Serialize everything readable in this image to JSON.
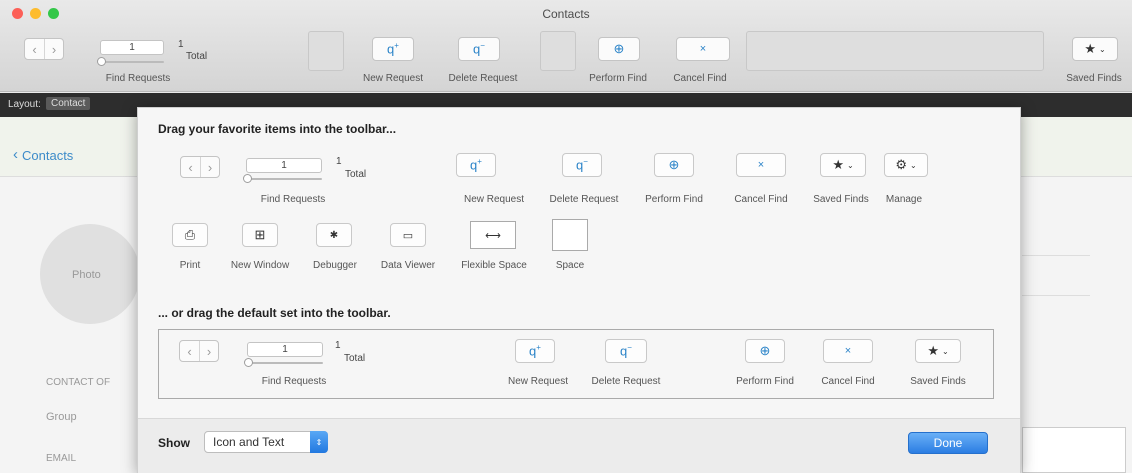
{
  "window": {
    "title": "Contacts"
  },
  "toolbar": {
    "record_current": "1",
    "record_total": "1",
    "record_total_label": "Total",
    "find_requests_label": "Find Requests",
    "new_request_label": "New Request",
    "delete_request_label": "Delete Request",
    "perform_find_label": "Perform Find",
    "cancel_find_label": "Cancel Find",
    "saved_finds_label": "Saved Finds"
  },
  "layout_bar": {
    "layout_label": "Layout:",
    "layout_value": "Contact"
  },
  "background": {
    "back_link": "Contacts",
    "photo_label": "Photo",
    "section_label": "CONTACT OF",
    "group_label": "Group",
    "email_label": "EMAIL"
  },
  "customize": {
    "heading_items": "Drag your favorite items into the toolbar...",
    "heading_default": "... or drag the default set into the toolbar.",
    "palette": {
      "record_current": "1",
      "record_total": "1",
      "record_total_label": "Total",
      "find_requests": "Find Requests",
      "new_request": "New Request",
      "delete_request": "Delete Request",
      "perform_find": "Perform Find",
      "cancel_find": "Cancel Find",
      "saved_finds": "Saved Finds",
      "manage": "Manage",
      "print": "Print",
      "new_window": "New Window",
      "debugger": "Debugger",
      "data_viewer": "Data Viewer",
      "flexible_space": "Flexible Space",
      "space": "Space"
    },
    "default_set": {
      "record_current": "1",
      "record_total": "1",
      "record_total_label": "Total",
      "find_requests": "Find Requests",
      "new_request": "New Request",
      "delete_request": "Delete Request",
      "perform_find": "Perform Find",
      "cancel_find": "Cancel Find",
      "saved_finds": "Saved Finds"
    },
    "show_label": "Show",
    "show_value": "Icon and Text",
    "done_label": "Done"
  },
  "colors": {
    "accent": "#2a83c8",
    "close": "#fc5f57",
    "minimize": "#fdbc2e",
    "zoom": "#34c749"
  },
  "icons": {
    "new_request": "query-plus-icon",
    "delete_request": "query-minus-icon",
    "perform_find": "magnifier-icon",
    "cancel_find": "x-icon",
    "saved_finds": "star-icon",
    "manage": "gear-icon",
    "print": "printer-icon",
    "new_window": "new-window-icon",
    "debugger": "bug-icon",
    "data_viewer": "data-viewer-icon"
  }
}
